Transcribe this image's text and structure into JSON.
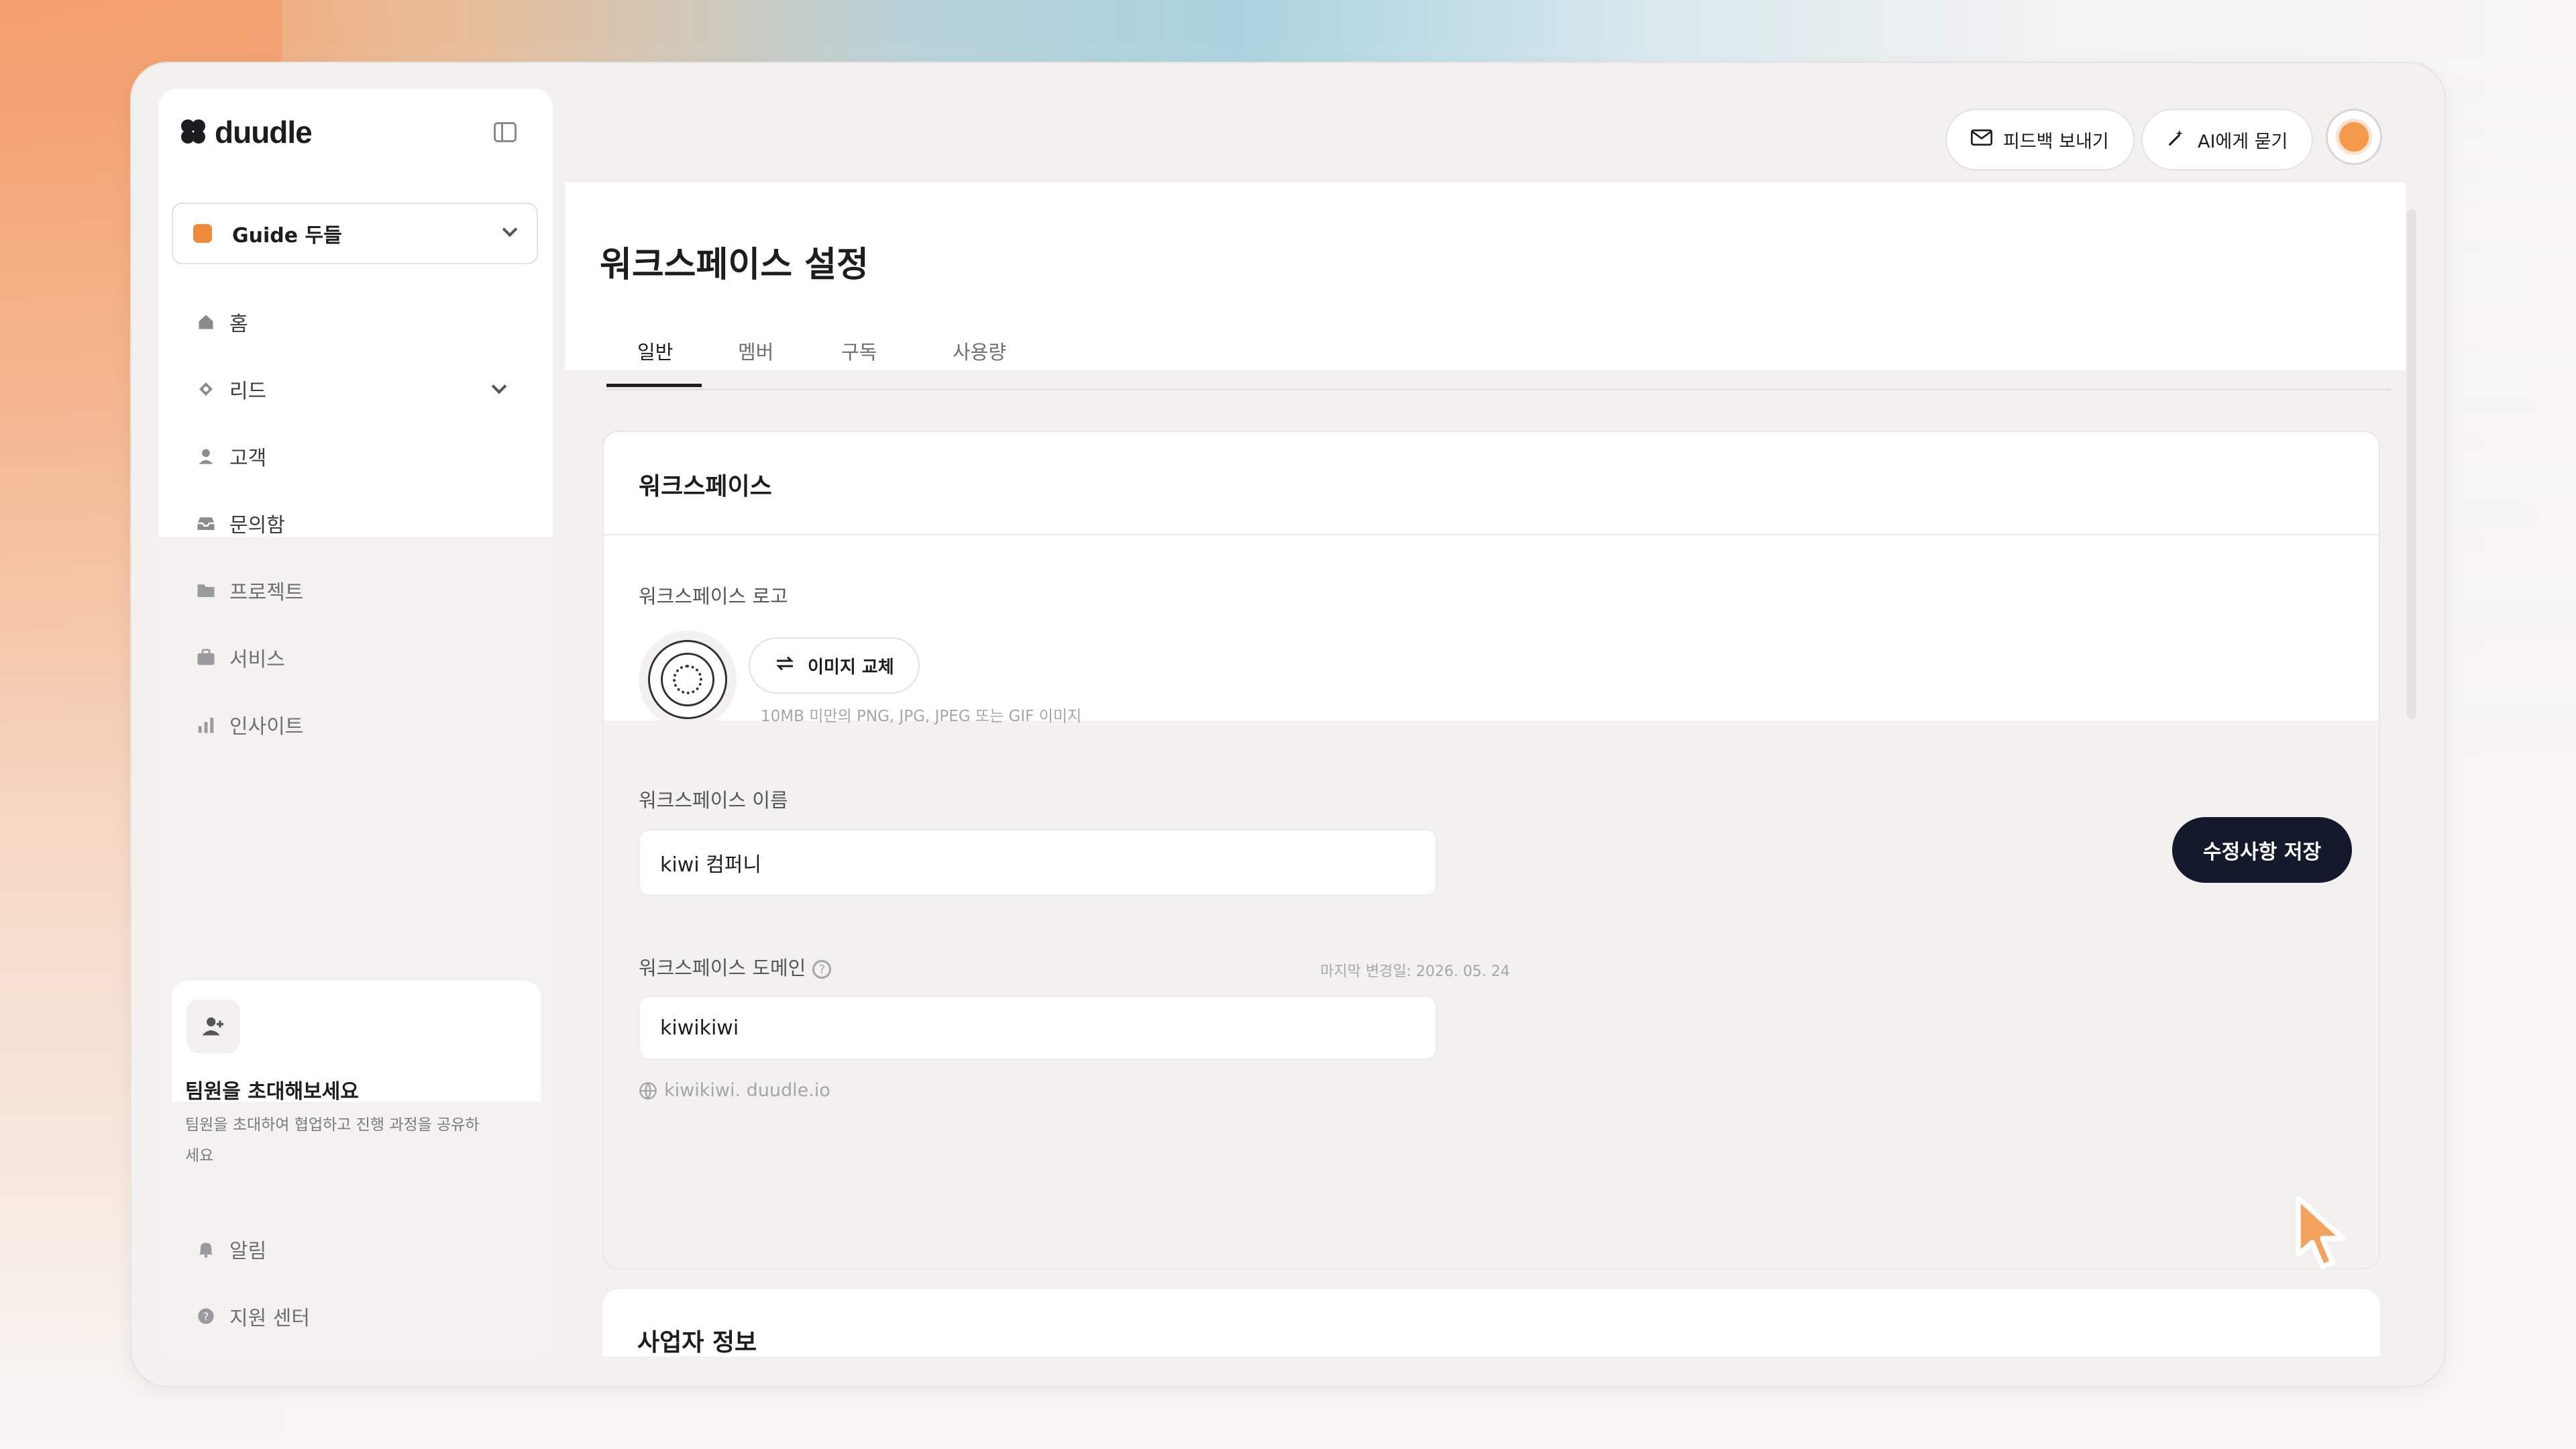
{
  "app": {
    "logo_text": "duudle"
  },
  "workspace_select": {
    "name": "Guide 두들"
  },
  "sidebar": {
    "items": [
      {
        "label": "홈",
        "icon": "home-icon"
      },
      {
        "label": "리드",
        "icon": "lead-icon"
      },
      {
        "label": "고객",
        "icon": "user-icon"
      },
      {
        "label": "문의함",
        "icon": "inbox-icon"
      },
      {
        "label": "프로젝트",
        "icon": "folder-icon"
      },
      {
        "label": "서비스",
        "icon": "briefcase-icon"
      },
      {
        "label": "인사이트",
        "icon": "chart-icon"
      }
    ],
    "bottom_items": [
      {
        "label": "알림",
        "icon": "bell-icon"
      },
      {
        "label": "지원 센터",
        "icon": "help-icon"
      }
    ],
    "invite": {
      "title": "팀원을 초대해보세요",
      "desc": "팀원을 초대하여 협업하고 진행 과정을 공유하세요"
    }
  },
  "header": {
    "feedback_label": "피드백 보내기",
    "ai_label": "AI에게 묻기"
  },
  "page": {
    "title": "워크스페이스 설정",
    "tabs": [
      "일반",
      "멤버",
      "구독",
      "사용량"
    ]
  },
  "workspace_card": {
    "title": "워크스페이스",
    "logo_label": "워크스페이스 로고",
    "replace_label": "이미지 교체",
    "logo_hint": "10MB 미만의 PNG, JPG, JPEG 또는 GIF 이미지",
    "name_label": "워크스페이스 이름",
    "name_value": "kiwi 컴퍼니",
    "domain_label": "워크스페이스 도메인",
    "domain_last_changed": "마지막 변경일: 2026. 05. 24",
    "domain_value": "kiwikiwi",
    "domain_url": "kiwikiwi. duudle.io",
    "save_label": "수정사항 저장"
  },
  "business_card": {
    "title": "사업자 정보"
  }
}
